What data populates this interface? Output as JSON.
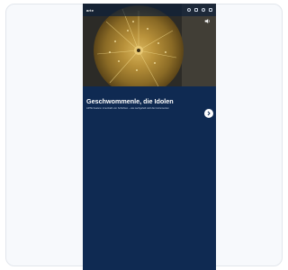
{
  "app": {
    "logo_text": "arte",
    "icons": [
      "search-icon",
      "bookmark-icon",
      "profile-icon",
      "menu-icon"
    ]
  },
  "hero": {
    "image_semantic": "golden-cymbal-image",
    "sound_icon": "speaker-icon"
  },
  "content": {
    "title": "Geschwommenle, die Idolen",
    "subtitle": "ARTE Feature: innenhalb von Schichten – wie nachgefeilt wird die Instrumenten"
  },
  "controls": {
    "next_icon": "chevron-right-icon"
  },
  "colors": {
    "brand_navy": "#0f2a52",
    "card_bg": "#f7f9fc",
    "border": "#e2e6ec",
    "cymbal_gold": "#b8913a"
  }
}
